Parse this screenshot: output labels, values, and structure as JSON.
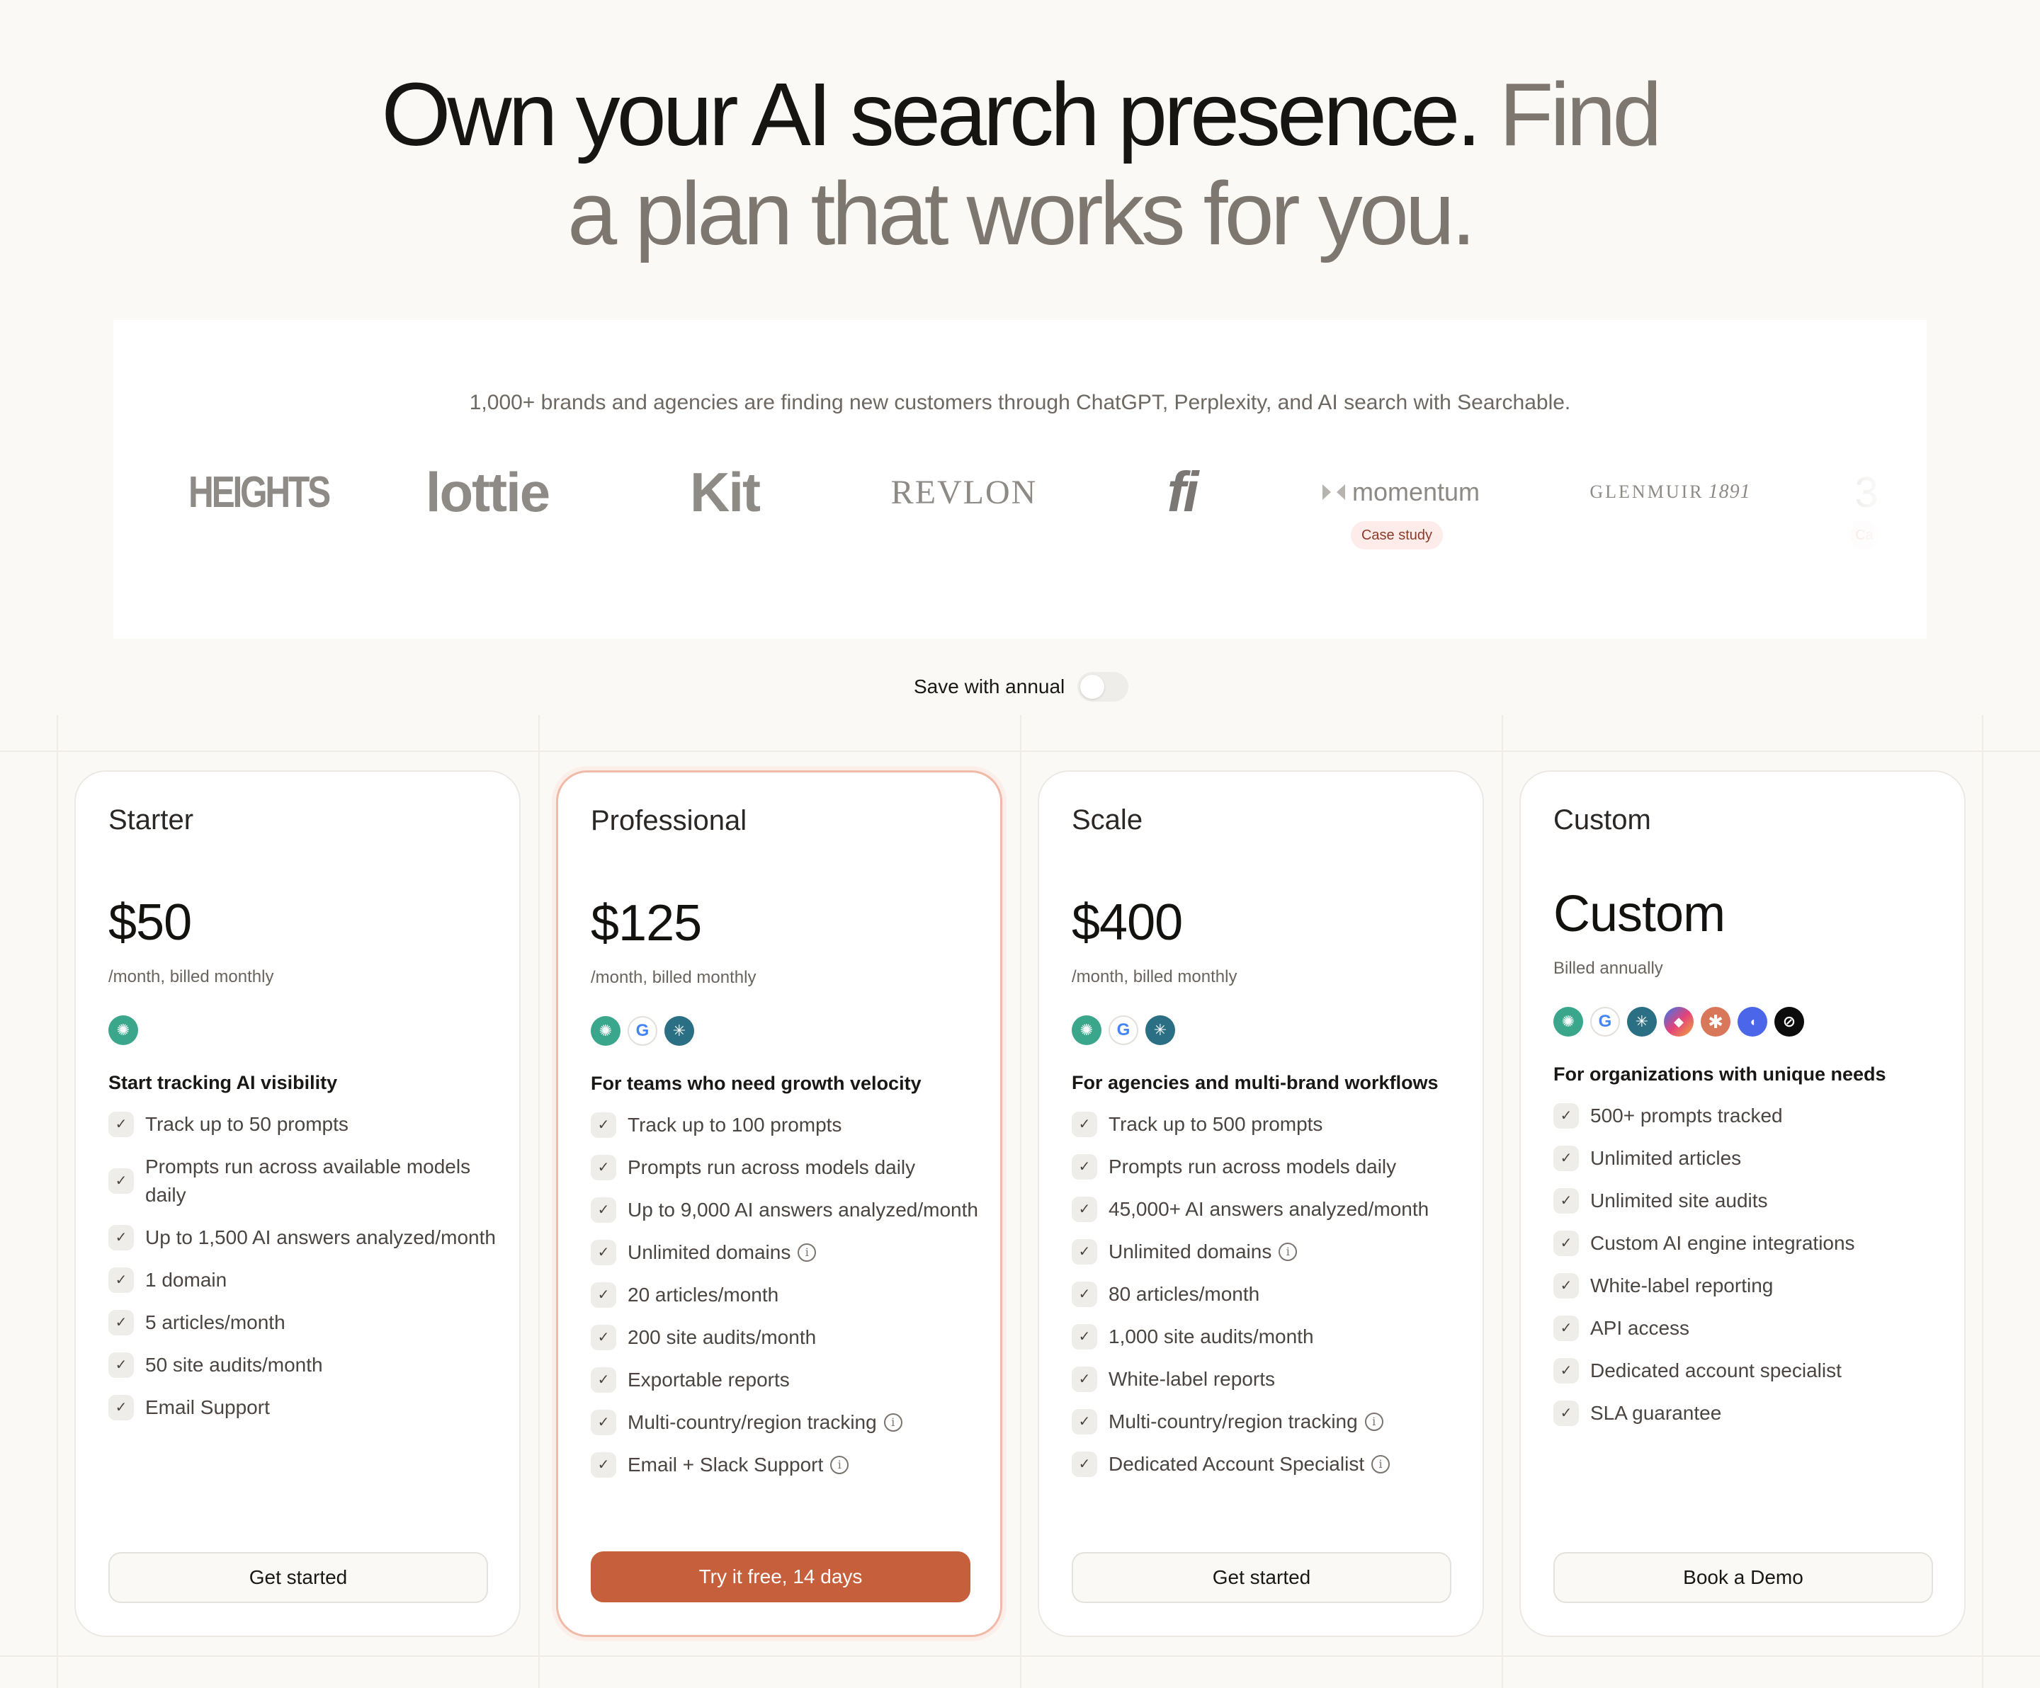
{
  "hero": {
    "headline_dark": "Own your AI search presence.",
    "headline_muted_1": "Find",
    "headline_muted_2": "a plan that works for you."
  },
  "social_proof": {
    "tagline": "1,000+ brands and agencies are finding new customers through ChatGPT, Perplexity, and AI search with Searchable.",
    "logos": [
      "HEIGHTS",
      "lottie",
      "Kit",
      "REVLON",
      "fi",
      "momentum",
      "GLENMUIR",
      "1891"
    ],
    "case_study_label": "Case study"
  },
  "billing": {
    "toggle_label": "Save with annual",
    "annual_enabled": false
  },
  "plans": [
    {
      "name": "Starter",
      "price": "$50",
      "period": "/month, billed monthly",
      "engines": [
        "openai-icon"
      ],
      "tagline": "Start tracking AI visibility",
      "features": [
        "Track up to 50 prompts",
        "Prompts run across available models daily",
        "Up to 1,500 AI answers analyzed/month",
        "1 domain",
        "5 articles/month",
        "50 site audits/month",
        "Email Support"
      ],
      "cta": "Get started"
    },
    {
      "name": "Professional",
      "price": "$125",
      "period": "/month, billed monthly",
      "engines": [
        "openai-icon",
        "google-icon",
        "perplexity-icon"
      ],
      "tagline": "For teams who need growth velocity",
      "features": [
        "Track up to 100 prompts",
        "Prompts run across models daily",
        "Up to 9,000 AI answers analyzed/month",
        "Unlimited domains",
        "20 articles/month",
        "200 site audits/month",
        "Exportable reports",
        "Multi-country/region tracking",
        "Email + Slack Support"
      ],
      "cta": "Try it free, 14 days",
      "accent": "#c65f3b"
    },
    {
      "name": "Scale",
      "price": "$400",
      "period": "/month, billed monthly",
      "engines": [
        "openai-icon",
        "google-icon",
        "perplexity-icon"
      ],
      "tagline": "For agencies and multi-brand workflows",
      "features": [
        "Track up to 500 prompts",
        "Prompts run across models daily",
        "45,000+ AI answers analyzed/month",
        "Unlimited domains",
        "80 articles/month",
        "1,000 site audits/month",
        "White-label reports",
        "Multi-country/region tracking",
        "Dedicated Account Specialist"
      ],
      "cta": "Get started"
    },
    {
      "name": "Custom",
      "price": "Custom",
      "period": "Billed annually",
      "engines": [
        "openai-icon",
        "google-icon",
        "perplexity-icon",
        "copilot-icon",
        "claude-icon",
        "deepseek-icon",
        "grok-icon"
      ],
      "tagline": "For organizations with unique needs",
      "features": [
        "500+ prompts tracked",
        "Unlimited articles",
        "Unlimited site audits",
        "Custom AI engine integrations",
        "White-label reporting",
        "API access",
        "Dedicated account specialist",
        "SLA guarantee"
      ],
      "cta": "Book a Demo"
    }
  ]
}
